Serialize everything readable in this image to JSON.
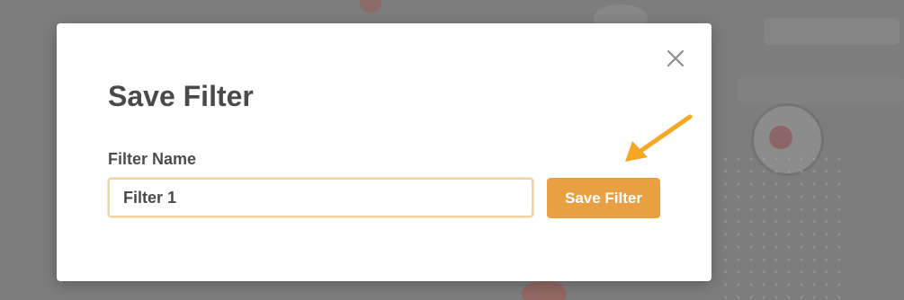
{
  "dialog": {
    "title": "Save Filter",
    "field_label": "Filter Name",
    "input_value": "Filter 1",
    "save_label": "Save Filter",
    "close_icon": "close-icon"
  },
  "annotation": {
    "arrow_icon": "arrow-pointer-icon",
    "arrow_color": "#f5a623"
  },
  "colors": {
    "accent": "#e9a042",
    "title_text": "#4a4a4a",
    "input_border": "#f2d4a3",
    "overlay": "#7d7d7d"
  }
}
